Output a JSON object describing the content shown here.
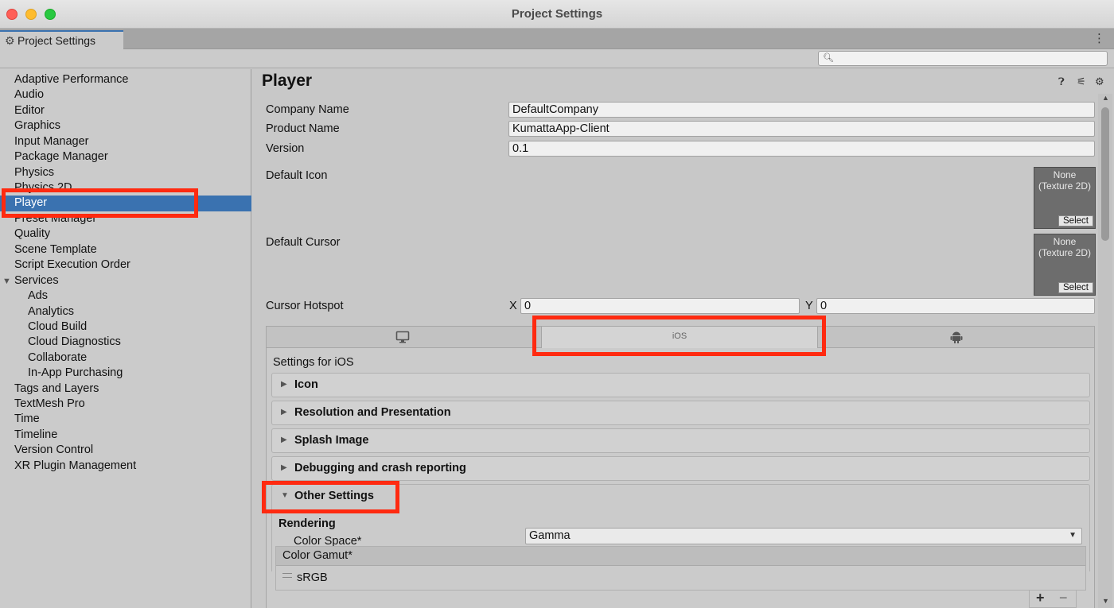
{
  "window": {
    "title": "Project Settings"
  },
  "tab": {
    "label": "Project Settings",
    "icon": "gear-icon"
  },
  "search": {
    "placeholder": ""
  },
  "sidebar": {
    "items": [
      {
        "label": "Adaptive Performance"
      },
      {
        "label": "Audio"
      },
      {
        "label": "Editor"
      },
      {
        "label": "Graphics"
      },
      {
        "label": "Input Manager"
      },
      {
        "label": "Package Manager"
      },
      {
        "label": "Physics"
      },
      {
        "label": "Physics 2D"
      },
      {
        "label": "Player",
        "selected": true
      },
      {
        "label": "Preset Manager"
      },
      {
        "label": "Quality"
      },
      {
        "label": "Scene Template"
      },
      {
        "label": "Script Execution Order"
      },
      {
        "label": "Services",
        "expanded": true
      },
      {
        "label": "Ads"
      },
      {
        "label": "Analytics"
      },
      {
        "label": "Cloud Build"
      },
      {
        "label": "Cloud Diagnostics"
      },
      {
        "label": "Collaborate"
      },
      {
        "label": "In-App Purchasing"
      },
      {
        "label": "Tags and Layers"
      },
      {
        "label": "TextMesh Pro"
      },
      {
        "label": "Time"
      },
      {
        "label": "Timeline"
      },
      {
        "label": "Version Control"
      },
      {
        "label": "XR Plugin Management"
      }
    ]
  },
  "player": {
    "title": "Player",
    "company_name_label": "Company Name",
    "company_name_value": "DefaultCompany",
    "product_name_label": "Product Name",
    "product_name_value": "KumattaApp-Client",
    "version_label": "Version",
    "version_value": "0.1",
    "default_icon_label": "Default Icon",
    "default_cursor_label": "Default Cursor",
    "texture_none_line1": "None",
    "texture_none_line2": "(Texture 2D)",
    "texture_select": "Select",
    "cursor_hotspot_label": "Cursor Hotspot",
    "hotspot_x_label": "X",
    "hotspot_x_value": "0",
    "hotspot_y_label": "Y",
    "hotspot_y_value": "0"
  },
  "platforms": {
    "tabs": [
      {
        "icon": "monitor-icon"
      },
      {
        "label": "iOS",
        "selected": true
      },
      {
        "icon": "android-icon"
      }
    ],
    "settings_for": "Settings for iOS",
    "sections": [
      {
        "label": "Icon",
        "expanded": false
      },
      {
        "label": "Resolution and Presentation",
        "expanded": false
      },
      {
        "label": "Splash Image",
        "expanded": false
      },
      {
        "label": "Debugging and crash reporting",
        "expanded": false
      },
      {
        "label": "Other Settings",
        "expanded": true
      }
    ],
    "rendering_header": "Rendering",
    "color_space_label": "Color Space*",
    "color_space_value": "Gamma",
    "color_gamut_header": "Color Gamut*",
    "color_gamut_items": [
      "sRGB"
    ],
    "add_symbol": "+",
    "remove_symbol": "−"
  },
  "colors": {
    "selection": "#3a72b0",
    "annotation": "#ff2a10"
  }
}
